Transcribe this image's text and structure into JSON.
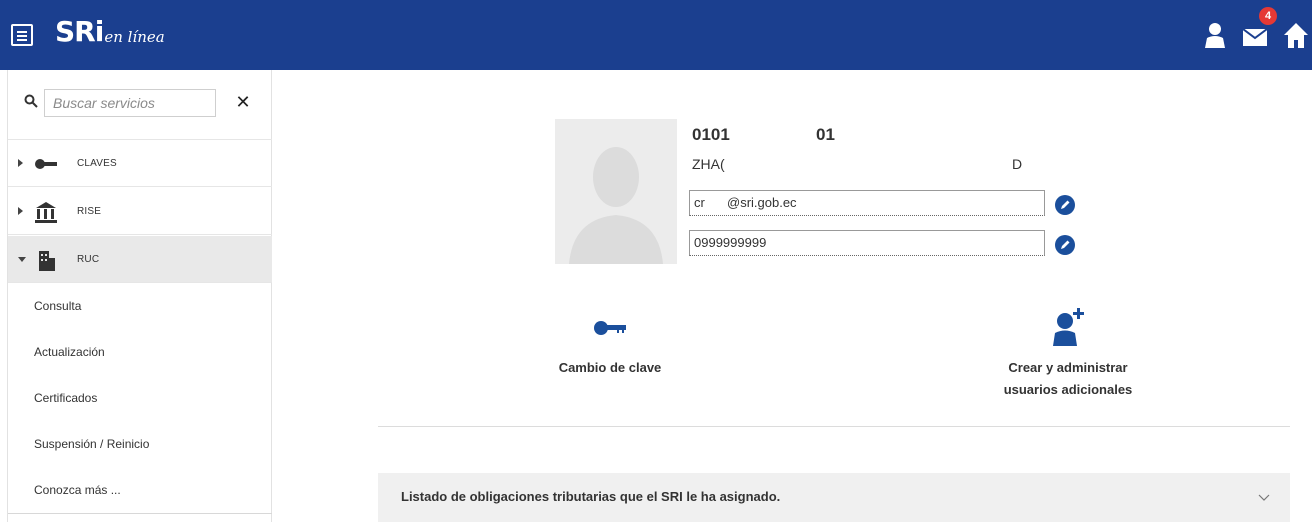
{
  "header": {
    "logo_main": "SRi",
    "logo_sub": "en línea",
    "mail_count": "4",
    "bar_color": "#1b3f8f"
  },
  "sidebar": {
    "search_placeholder": "Buscar servicios",
    "clear_label": "✕",
    "items": [
      {
        "label": "CLAVES",
        "icon": "key-icon",
        "expanded": false
      },
      {
        "label": "RISE",
        "icon": "building-bank-icon",
        "expanded": false
      },
      {
        "label": "RUC",
        "icon": "building-icon",
        "expanded": true
      }
    ],
    "subitems": [
      "Consulta",
      "Actualización",
      "Certificados",
      "Suspensión / Reinicio",
      "Conozca más ..."
    ]
  },
  "profile": {
    "ruc_prefix": "0101",
    "ruc_suffix": "01",
    "name_prefix": "ZHA(",
    "name_suffix": "D",
    "email_prefix": "cr",
    "email_suffix": "@sri.gob.ec",
    "phone": "0999999999"
  },
  "actions": {
    "change_password": "Cambio de clave",
    "manage_users_line1": "Crear y administrar",
    "manage_users_line2": "usuarios adicionales"
  },
  "obligations": {
    "title": "Listado de obligaciones tributarias que el SRI le ha asignado."
  },
  "colors": {
    "primary": "#1b3f8f",
    "icon_blue": "#1b4f9c",
    "badge": "#e53935"
  }
}
